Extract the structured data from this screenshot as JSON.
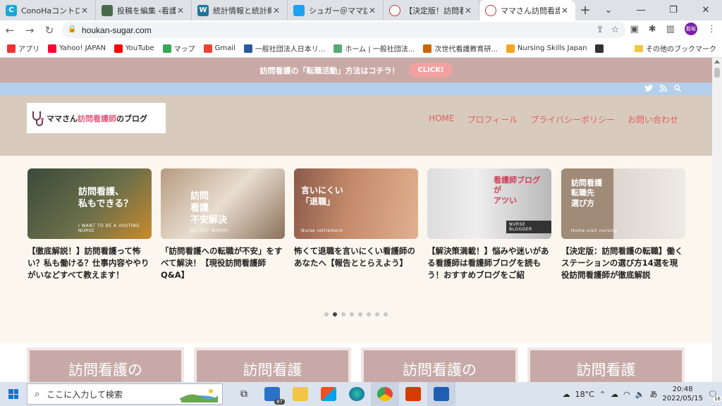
{
  "browser": {
    "tabs": [
      {
        "title": "ConoHaコントロールパネル",
        "icon": "conoha-icon",
        "color": "#19a9d8",
        "glyph": "C"
      },
      {
        "title": "投稿を編集 ‹看護師",
        "icon": "image-icon",
        "color": "#4a6b4a",
        "glyph": ""
      },
      {
        "title": "統計情報と統計概要",
        "icon": "wordpress-icon",
        "color": "#21759b",
        "glyph": "W"
      },
      {
        "title": "シュガー＠ママ訪問看",
        "icon": "twitter-icon",
        "color": "#1da1f2",
        "glyph": ""
      },
      {
        "title": "【決定版！訪問看護",
        "icon": "site-favicon-icon",
        "color": "#ffffff",
        "glyph": ""
      },
      {
        "title": "ママさん訪問看護師の",
        "icon": "site-favicon-icon",
        "color": "#ffffff",
        "glyph": ""
      }
    ],
    "new_tab": "+",
    "url": "houkan-sugar.com",
    "avatar_text": "毅裕",
    "bookmarks": [
      {
        "label": "アプリ",
        "color": "#e33"
      },
      {
        "label": "Yahoo! JAPAN",
        "color": "#f03"
      },
      {
        "label": "YouTube",
        "color": "#f00"
      },
      {
        "label": "マップ",
        "color": "#34a853"
      },
      {
        "label": "Gmail",
        "color": "#ea4335"
      },
      {
        "label": "一般社団法人日本リ...",
        "color": "#2c5aa0"
      },
      {
        "label": "ホーム | 一般社団法...",
        "color": "#5a7"
      },
      {
        "label": "次世代看護教育研...",
        "color": "#c60"
      },
      {
        "label": "Nursing Skills Japan",
        "color": "#f5a623"
      },
      {
        "label": "",
        "color": "#333"
      }
    ],
    "bookmarks_more": "»",
    "other_bookmarks": "その他のブックマーク"
  },
  "site": {
    "promo_text": "訪問看護の「転職活動」方法はコチラ！",
    "promo_button": "CLICK!",
    "logo_text_a": "ママさん",
    "logo_text_b": "訪問看護師",
    "logo_text_c": "のブログ",
    "nav": [
      "HOME",
      "プロフィール",
      "プライバシーポリシー",
      "お問い合わせ"
    ],
    "cards": [
      {
        "caption": "訪問看護、\n私もできる？",
        "sub": "I WANT TO BE A VISITING NURSE",
        "bg": "linear-gradient(135deg,#3a4a3a,#6b6f4a 55%,#c98a2c)",
        "title": "【徹底解説！】訪問看護って怖い？私も働ける？仕事内容ややりがいなどすべて教えます！"
      },
      {
        "caption": "訪問\n看護\n不安解決",
        "sub": "DO NOT WORRY",
        "bg": "linear-gradient(135deg,#b79b80,#e8ddd0 50%,#8a7058)",
        "title": "「訪問看護への転職が不安」をすべて解決！【現役訪問看護師Q&A】"
      },
      {
        "caption": "言いにくい\n「退職」",
        "sub": "Nurse retirement",
        "bg": "linear-gradient(100deg,#8b5a4a,#c48b6b 45%,#e0b090)",
        "title": "怖くて退職を言いにくい看護師のあなたへ【報告ととらえよう】"
      },
      {
        "caption": "看護師ブログ\nが\nアツい",
        "sub": "NURSE BLOGGER",
        "bg": "linear-gradient(90deg,#ddd 0%,#eee 40%,#b8b8b8 100%)",
        "title": "【解決策満載！】悩みや迷いがある看護師は看護師ブログを読もう！おすすめブログをご紹"
      },
      {
        "caption": "訪問看護\n転職先\n選び方",
        "sub": "Home-visit nursing",
        "bg": "linear-gradient(90deg,#a08a78 0%,#a08a78 42%,#dcd6cf 42%,#eeeae6 100%)",
        "title": "【決定版：訪問看護の転職】働くステーションの選び方14選を現役訪問看護師が徹底解説"
      }
    ],
    "dots": 8,
    "active_dot": 1,
    "menu_boxes": [
      "訪問看護の",
      "訪問看護",
      "訪問看護の",
      "訪問看護"
    ]
  },
  "taskbar": {
    "search_placeholder": "ここに入力して検索",
    "mail_badge": "87",
    "weather": "18°C",
    "ime": "あ",
    "time": "20:48",
    "date": "2022/05/15",
    "notification_count": "16"
  },
  "colors": {
    "promo_bg": "#c9a9a6",
    "social_bg": "#b4cfe9",
    "header_bg": "#d8cbbd",
    "nav_text": "#e06060",
    "page_bg": "#fbf7ef"
  }
}
